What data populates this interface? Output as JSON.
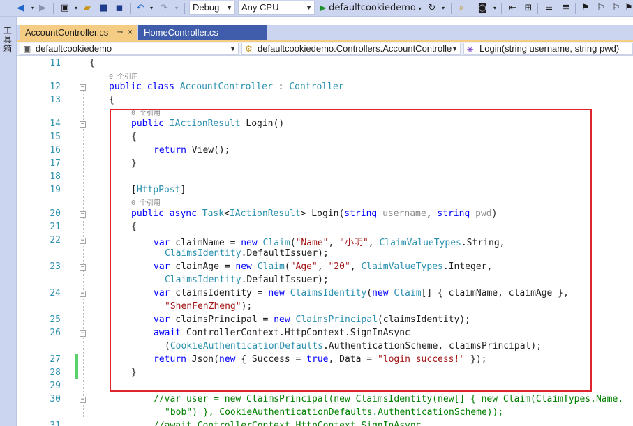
{
  "toolbar": {
    "config_value": "Debug",
    "platform_value": "Any CPU",
    "start_label": "defaultcookiedemo"
  },
  "toolstrip": {
    "label": "工具箱"
  },
  "tabs": [
    {
      "label": "AccountController.cs",
      "pin": "⊸",
      "close": "×"
    },
    {
      "label": "HomeController.cs"
    }
  ],
  "navbar": {
    "project": "defaultcookiedemo",
    "type": "defaultcookiedemo.Controllers.AccountControlle",
    "member": "Login(string username, string pwd)"
  },
  "editor": {
    "ref_label": "0 个引用",
    "line_numbers": [
      "11",
      "12",
      "13",
      "14",
      "15",
      "16",
      "17",
      "18",
      "19",
      "20",
      "21",
      "22",
      "23",
      "24",
      "25",
      "26",
      "27",
      "28",
      "29",
      "30",
      "31"
    ]
  },
  "colors": {
    "keyword": "#0000ff",
    "type": "#2b91af",
    "string": "#a31515",
    "highlight_box": "#e0242d",
    "change_bar": "#57d26a"
  }
}
